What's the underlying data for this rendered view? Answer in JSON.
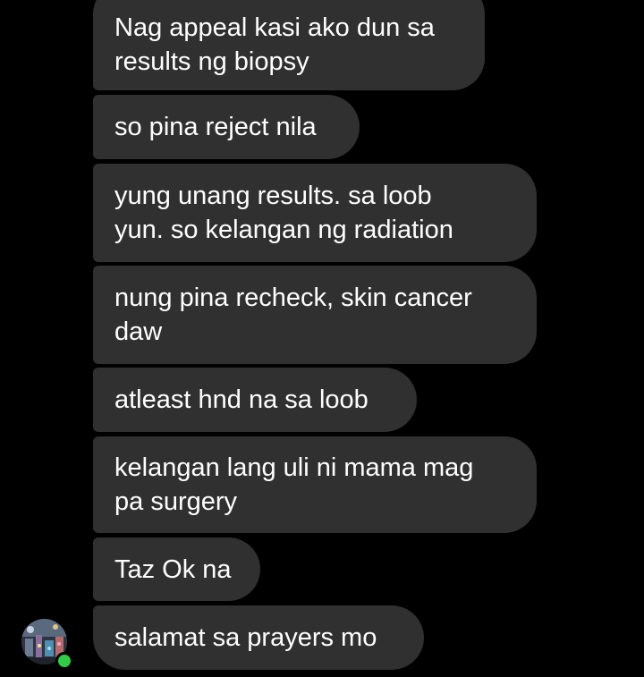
{
  "conversation": {
    "messages": [
      {
        "lines": [
          "Nag appeal kasi ako dun sa",
          "results ng biopsy"
        ]
      },
      {
        "lines": [
          "so pina reject nila"
        ]
      },
      {
        "lines": [
          "yung unang results. sa loob",
          "yun. so kelangan ng radiation"
        ]
      },
      {
        "lines": [
          "nung pina recheck, skin cancer",
          "daw"
        ]
      },
      {
        "lines": [
          "atleast hnd na sa loob"
        ]
      },
      {
        "lines": [
          "kelangan lang uli ni mama mag",
          "pa surgery"
        ]
      },
      {
        "lines": [
          "Taz Ok na"
        ]
      },
      {
        "lines": [
          "salamat sa prayers mo"
        ]
      }
    ]
  },
  "sender": {
    "avatar_icon": "profile-photo",
    "presence": "online",
    "presence_color": "#31cc46"
  },
  "colors": {
    "background": "#000000",
    "bubble": "#303030",
    "text": "#ffffff"
  }
}
